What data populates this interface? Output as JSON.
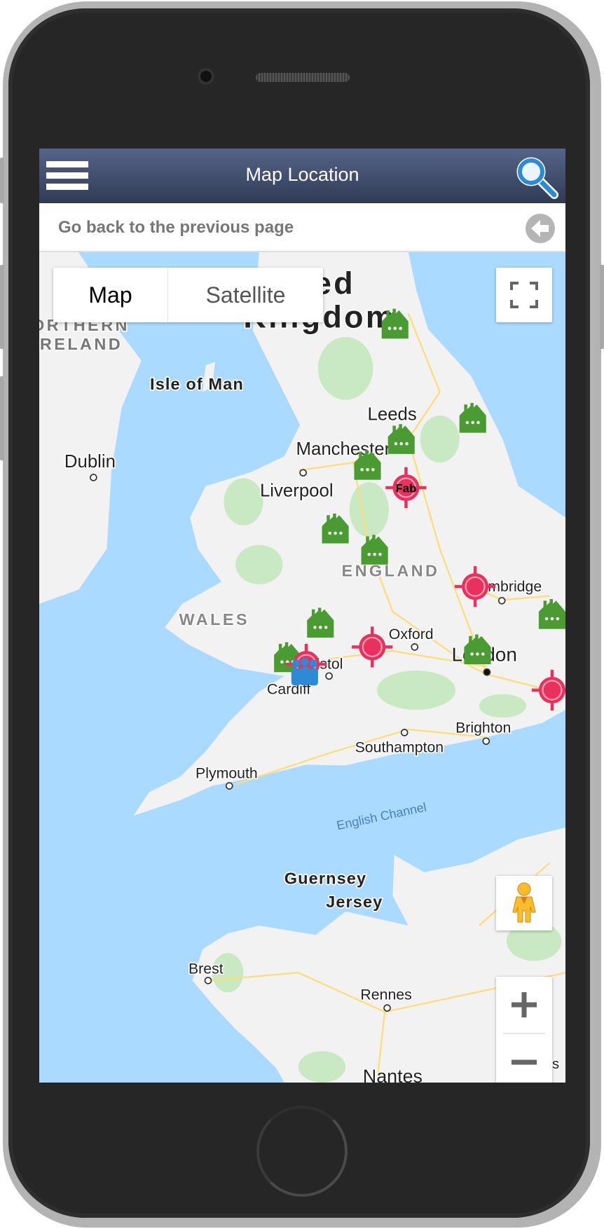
{
  "header": {
    "title": "Map Location",
    "menu_icon": "hamburger-menu-icon",
    "search_icon": "magnifier-search-icon"
  },
  "back": {
    "label": "Go back to the previous page",
    "icon": "arrow-left-circle-icon"
  },
  "map": {
    "type_control": {
      "map": "Map",
      "satellite": "Satellite",
      "selected": "Map"
    },
    "labels": {
      "united": "United",
      "kingdom": "Kingdom",
      "northern": "NORTHERN",
      "ireland": "IRELAND",
      "isle_of_man": "Isle of Man",
      "dublin": "Dublin",
      "leeds": "Leeds",
      "manchester": "Manchester",
      "liverpool": "Liverpool",
      "england": "ENGLAND",
      "wales": "WALES",
      "oxford": "Oxford",
      "cambridge": "Cambridge",
      "london": "London",
      "bristol": "Bristol",
      "cardiff": "Cardiff",
      "brighton": "Brighton",
      "southampton": "Southampton",
      "plymouth": "Plymouth",
      "english_channel": "English Channel",
      "guernsey": "Guernsey",
      "jersey": "Jersey",
      "brest": "Brest",
      "rennes": "Rennes",
      "nantes": "Nantes",
      "edge_s": "s"
    },
    "markers": {
      "fab_label": "Fab",
      "factory_color": "#4a9c32",
      "target_color": "#e8315f",
      "group_color": "#2f8ad6"
    },
    "colors": {
      "water": "#aadaff",
      "land": "#f2f2f2",
      "park": "#c8e9c1",
      "road": "#fddc7a"
    }
  }
}
